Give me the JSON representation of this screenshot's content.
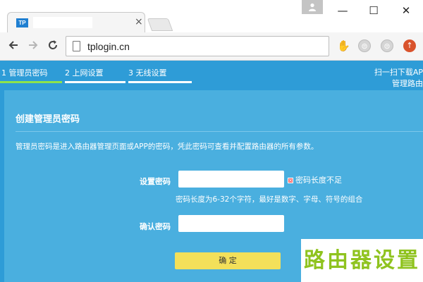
{
  "browser": {
    "tab_favicon": "TP",
    "tab_close": "×",
    "window_minimize": "—",
    "window_maximize": "☐",
    "window_close": "✕",
    "url": "tplogin.cn",
    "icons": [
      "back-icon",
      "forward-icon",
      "reload-icon",
      "page-icon",
      "extension-icon",
      "orange-upload-icon"
    ]
  },
  "steps": [
    {
      "label": "1 管理员密码",
      "active": true
    },
    {
      "label": "2 上网设置",
      "active": false
    },
    {
      "label": "3 无线设置",
      "active": false
    }
  ],
  "promo": {
    "line1": "扫一扫下载AP",
    "line2": "管理路由"
  },
  "form": {
    "title": "创建管理员密码",
    "description": "管理员密码是进入路由器管理页面或APP的密码，凭此密码可查看并配置路由器的所有参数。",
    "password_label": "设置密码",
    "password_value": "",
    "error_text": "密码长度不足",
    "hint": "密码长度为6-32个字符，最好是数字、字母、符号的组合",
    "confirm_label": "确认密码",
    "confirm_value": "",
    "submit_label": "确 定"
  },
  "watermark": "路由器设置",
  "colors": {
    "page_bg": "#2e9cd7",
    "panel_bg": "#4aafdf",
    "active_step": "#8ee34a",
    "button": "#f3e05a",
    "watermark": "#8fc31f"
  }
}
